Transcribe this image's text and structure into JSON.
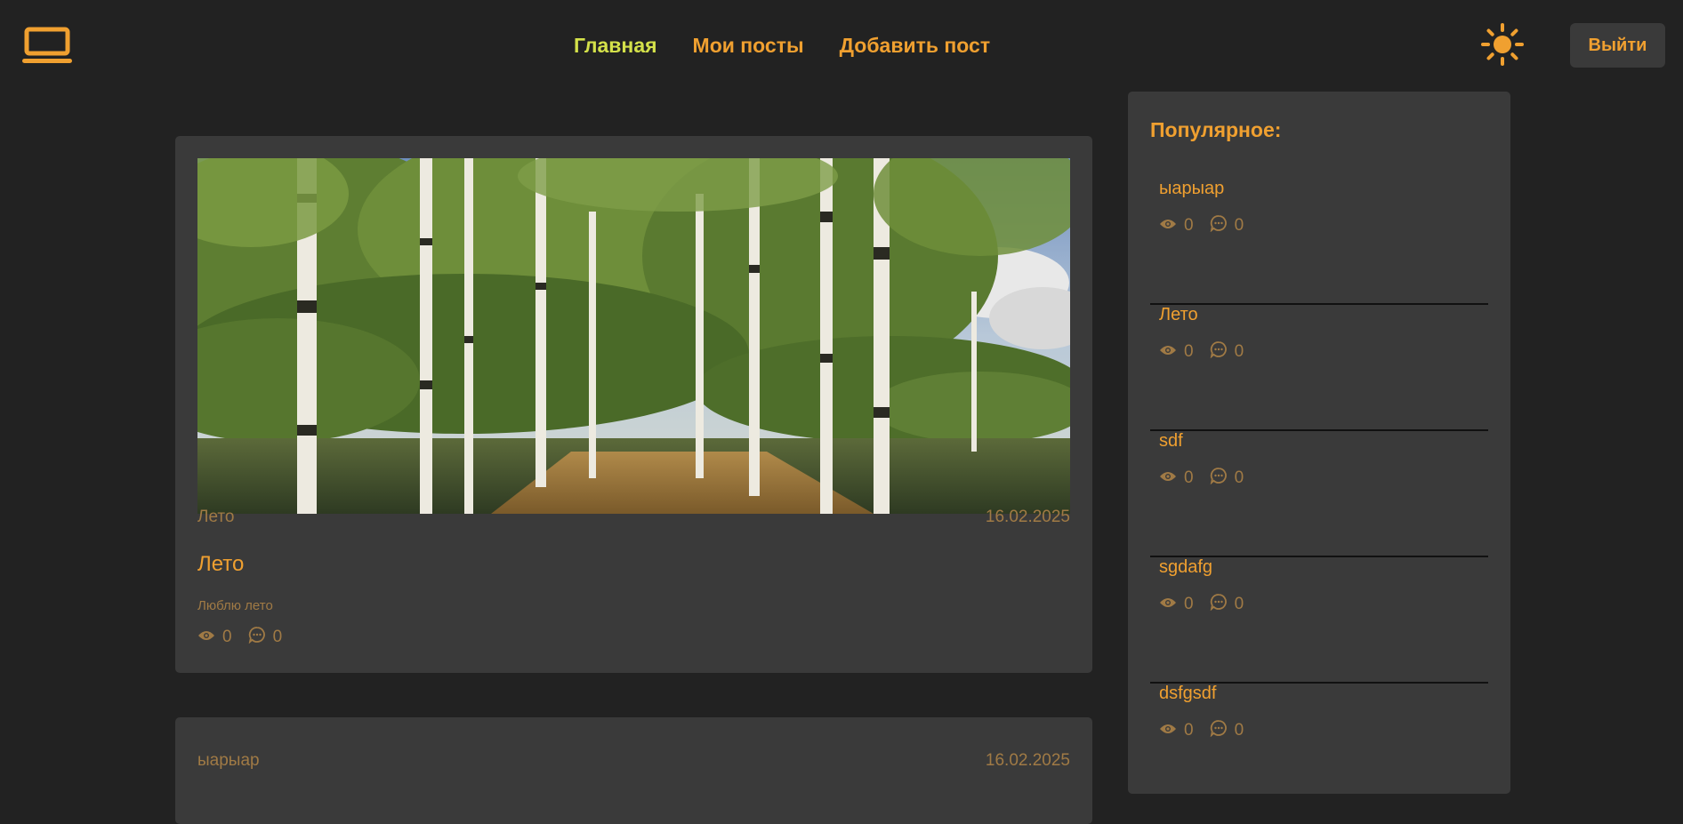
{
  "nav": {
    "items": [
      {
        "label": "Главная",
        "active": true
      },
      {
        "label": "Мои посты",
        "active": false
      },
      {
        "label": "Добавить пост",
        "active": false
      }
    ],
    "logout_label": "Выйти"
  },
  "icons": {
    "logo": "laptop-icon",
    "theme": "sun-icon",
    "views": "eye-icon",
    "comments": "comment-icon"
  },
  "colors": {
    "background": "#222222",
    "card": "#3A3A3A",
    "accent": "#F0A030",
    "active_nav": "#D4E14A",
    "muted": "#A07A45"
  },
  "posts": [
    {
      "tag": "Лето",
      "date": "16.02.2025",
      "title": "Лето",
      "text": "Люблю лето",
      "views": "0",
      "comments": "0"
    },
    {
      "tag": "ыарыар",
      "date": "16.02.2025"
    }
  ],
  "sidebar": {
    "title": "Популярное:",
    "items": [
      {
        "title": "ыарыар",
        "views": "0",
        "comments": "0"
      },
      {
        "title": "Лето",
        "views": "0",
        "comments": "0"
      },
      {
        "title": "sdf",
        "views": "0",
        "comments": "0"
      },
      {
        "title": "sgdafg",
        "views": "0",
        "comments": "0"
      },
      {
        "title": "dsfgsdf",
        "views": "0",
        "comments": "0"
      }
    ]
  }
}
